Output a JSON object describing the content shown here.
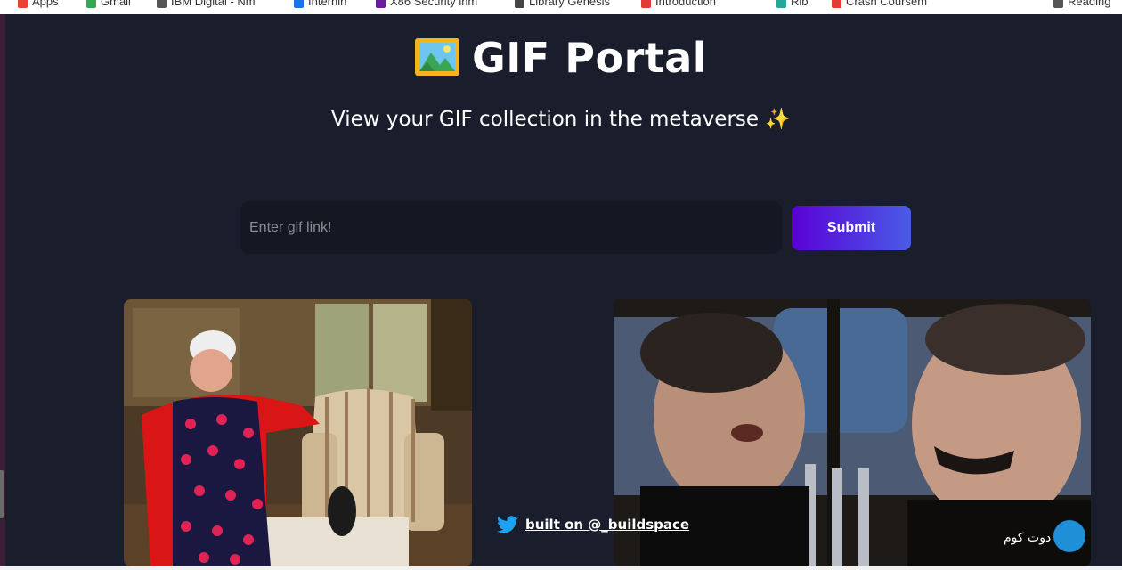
{
  "browser": {
    "bookmarks": [
      {
        "label": "Apps",
        "color": "#e94235"
      },
      {
        "label": "Gmail",
        "color": "#34a853"
      },
      {
        "label": "IBM Digital - Nm",
        "color": "#555555"
      },
      {
        "label": "Internin",
        "color": "#1a73e8"
      },
      {
        "label": "X86 Security inm",
        "color": "#6a1b9a"
      },
      {
        "label": "Library Genesis",
        "color": "#444444"
      },
      {
        "label": "Introduction",
        "color": "#e53935"
      },
      {
        "label": "Rib",
        "color": "#26a69a"
      },
      {
        "label": "Crash Coursem",
        "color": "#e53935"
      },
      {
        "label": "Reading",
        "color": "#555555"
      }
    ]
  },
  "header": {
    "title": "GIF Portal",
    "title_icon": "framed-picture-icon",
    "subtitle": "View your GIF collection in the metaverse",
    "subtitle_emoji": "✨"
  },
  "form": {
    "placeholder": "Enter gif link!",
    "value": "",
    "submit_label": "Submit"
  },
  "gifs": [
    {
      "name": "gif-woman-dancing-red-cape"
    },
    {
      "name": "gif-two-men-talking"
    }
  ],
  "gif_watermark": "دوت كوم",
  "footer": {
    "icon": "twitter-icon",
    "text": "built on @_buildspace",
    "color": "#1da1f2"
  },
  "colors": {
    "background": "#1a1d2b",
    "input_bg": "#151722",
    "button_gradient_start": "#5a00d6",
    "button_gradient_end": "#4a5ce8"
  }
}
